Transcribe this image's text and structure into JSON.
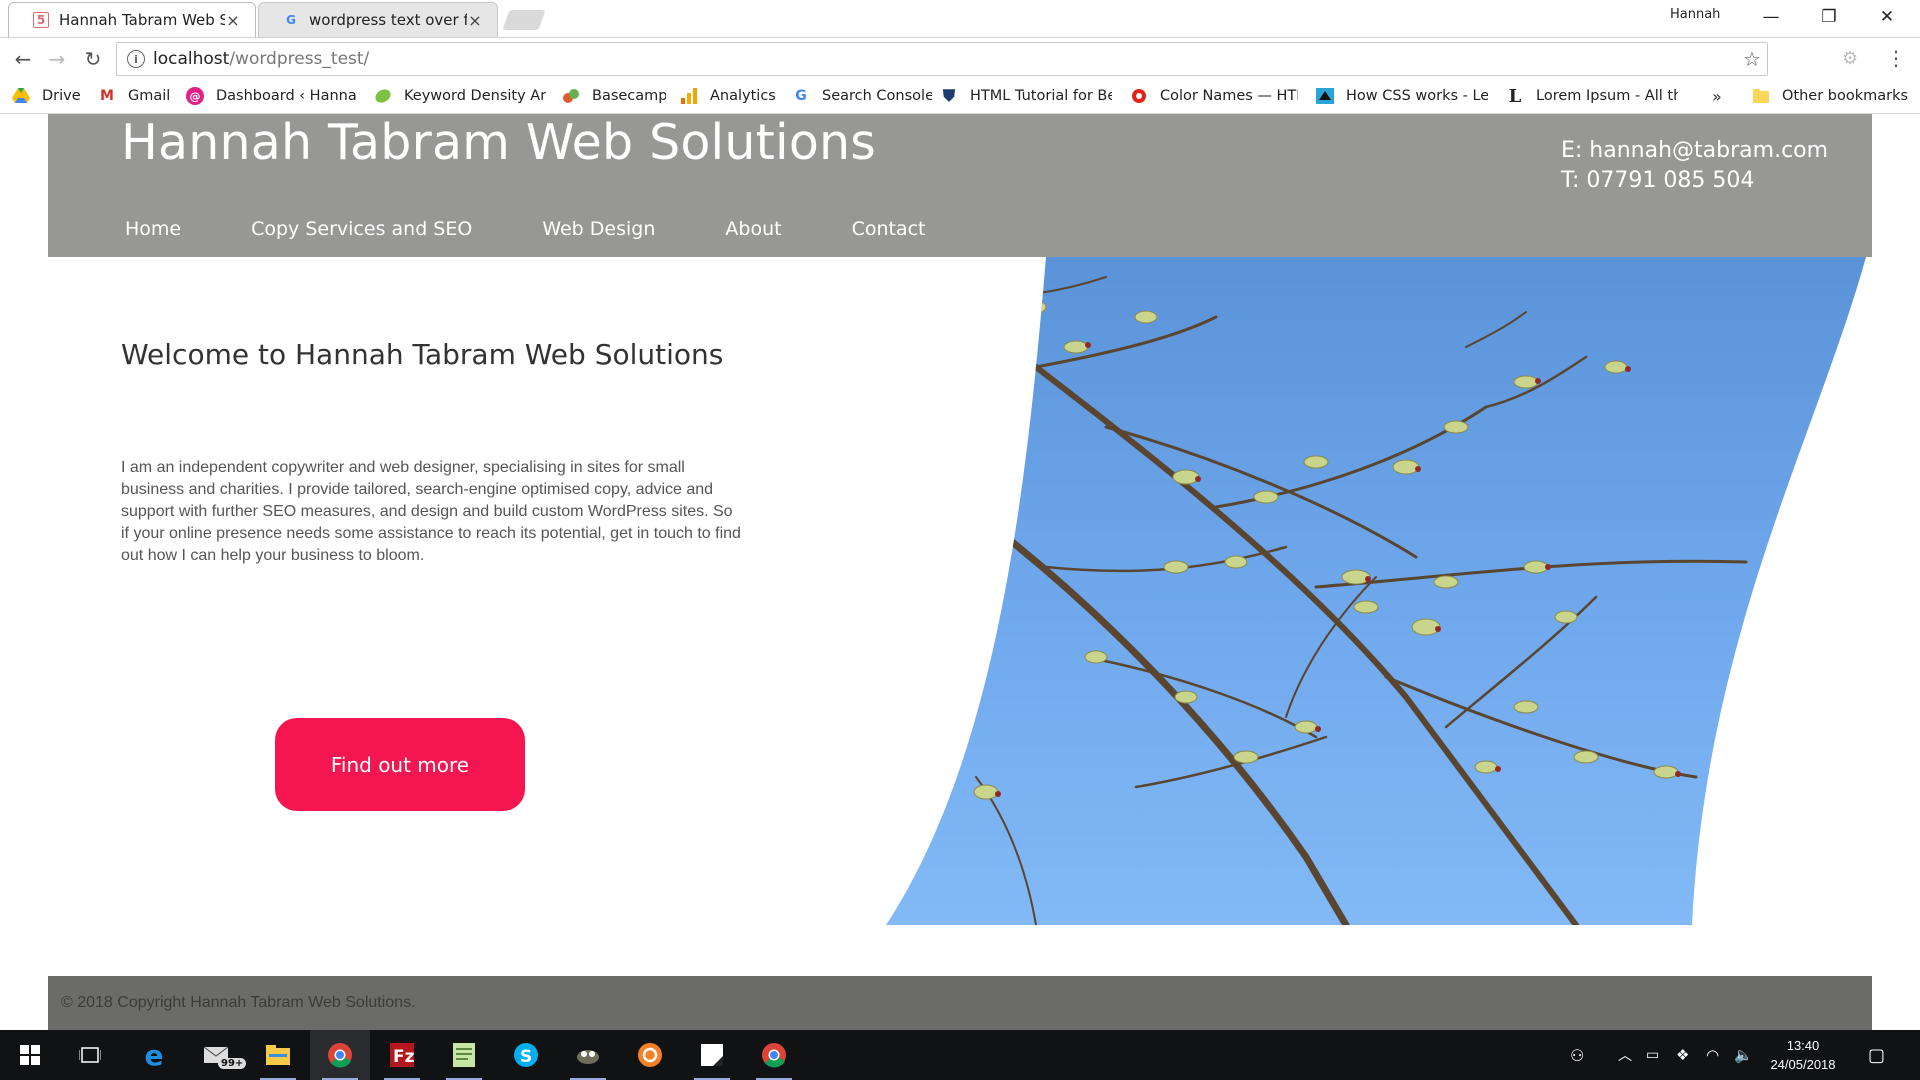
{
  "browser": {
    "tabs": [
      {
        "title": "Hannah Tabram Web Solu",
        "active": true
      },
      {
        "title": "wordpress text over featu",
        "active": false
      }
    ],
    "user_name": "Hannah",
    "window_controls": {
      "minimize": "—",
      "maximize": "❐",
      "close": "✕"
    },
    "nav": {
      "back": "←",
      "forward": "→",
      "reload": "↻"
    },
    "address": {
      "host": "localhost",
      "path": "/wordpress_test/"
    },
    "bookmarks": [
      {
        "label": "Drive",
        "icon": "drive-icon",
        "color": "#1fa463"
      },
      {
        "label": "Gmail",
        "icon": "gmail-icon",
        "color": "#d93025"
      },
      {
        "label": "Dashboard ‹ Hannah",
        "icon": "dashboard-icon",
        "color": "#e0218a"
      },
      {
        "label": "Keyword Density An",
        "icon": "keyword-icon",
        "color": "#7cc242"
      },
      {
        "label": "Basecamp",
        "icon": "basecamp-icon",
        "color": "#e05a2b"
      },
      {
        "label": "Analytics",
        "icon": "analytics-icon",
        "color": "#f4a300"
      },
      {
        "label": "Search Console",
        "icon": "google-icon",
        "color": "#4285f4"
      },
      {
        "label": "HTML Tutorial for Be",
        "icon": "shield-icon",
        "color": "#1e3a6e"
      },
      {
        "label": "Color Names — HTM",
        "icon": "color-icon",
        "color": "#e2231a"
      },
      {
        "label": "How CSS works - Le",
        "icon": "mdn-icon",
        "color": "#111111"
      },
      {
        "label": "Lorem Ipsum - All th",
        "icon": "lorem-icon",
        "color": "#222222"
      }
    ],
    "bookmarks_more": "»",
    "other_bookmarks": "Other bookmarks"
  },
  "site": {
    "title": "Hannah Tabram Web Solutions",
    "email": "E: hannah@tabram.com",
    "phone": "T: 07791 085 504",
    "nav": [
      "Home",
      "Copy Services and SEO",
      "Web Design",
      "About",
      "Contact"
    ],
    "heading": "Welcome to Hannah Tabram Web Solutions",
    "intro": "I am an independent copywriter and web designer, specialising in sites for small business and charities. I provide tailored, search-engine optimised copy, advice and support with further SEO measures, and design and build custom WordPress sites. So if your online presence needs some assistance to reach its potential, get in touch to find out how I can help your business to bloom.",
    "cta": "Find out more",
    "copyright": "© 2018 Copyright Hannah Tabram Web Solutions.",
    "colors": {
      "header_bg": "#979896",
      "cta_bg": "#f51551",
      "footer_bg": "#6b6c69",
      "sky": "#6fa8e8"
    }
  },
  "taskbar": {
    "mail_badge": "99+",
    "time": "13:40",
    "date": "24/05/2018"
  }
}
